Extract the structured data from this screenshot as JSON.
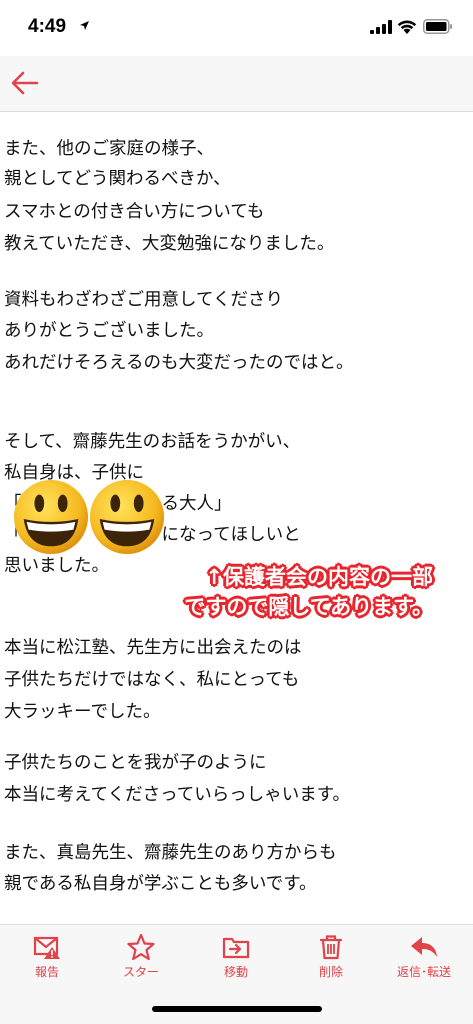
{
  "status_bar": {
    "time": "4:49"
  },
  "nav": {
    "back_icon": "back-arrow-icon"
  },
  "body": {
    "lines": [
      "また、他のご家庭の様子、",
      "親としてどう関わるべきか、",
      "スマホとの付き合い方についても",
      "教えていただき、大変勉強になりました。",
      "資料もわざわざご用意してくださり",
      "ありがとうございました。",
      "あれだけそろえるのも大変だったのではと。",
      "そして、齋藤先生のお話をうかがい、",
      "私自身は、子供に",
      "「　　　　　　　　る大人」",
      "「　　　　　大人」になってほしいと",
      "思いました。",
      "本当に松江塾、先生方に出会えたのは",
      "子供たちだけではなく、私にとっても",
      "大ラッキーでした。",
      "子供たちのことを我が子のように",
      "本当に考えてくださっていらっしゃいます。",
      "また、真島先生、齋藤先生のあり方からも",
      "親である私自身が学ぶことも多いです。"
    ]
  },
  "annotation": {
    "line1": "↑保護者会の内容の一部",
    "line2": "ですので隠してあります。",
    "color": "#e8252c"
  },
  "toolbar": {
    "accent": "#e0434a",
    "items": [
      {
        "label": "報告",
        "icon": "report-mail-icon"
      },
      {
        "label": "スター",
        "icon": "star-icon"
      },
      {
        "label": "移動",
        "icon": "move-folder-icon"
      },
      {
        "label": "削除",
        "icon": "trash-icon"
      },
      {
        "label": "返信･転送",
        "icon": "reply-icon"
      }
    ]
  }
}
